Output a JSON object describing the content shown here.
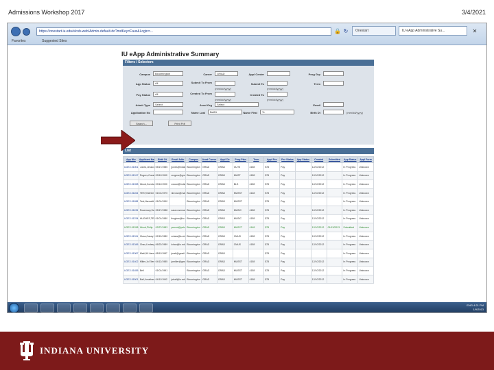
{
  "slide": {
    "header_left": "Admissions Workshop 2017",
    "header_right": "3/4/2021"
  },
  "browser": {
    "address": "https://onestart.iu.edu/slcsb-web/Admin-default.do?mdKey=Faux&Login=...",
    "tab1": "Onestart",
    "tab2": "IU eApp Administrative Su...",
    "fav1": "Favorites",
    "fav2": "Suggested Sites"
  },
  "page": {
    "title": "IU eApp Administrative Summary",
    "filters_header": "Filters / Selectors",
    "list_header": "List",
    "filters": {
      "campus_label": "Campus",
      "campus_value": "Bloomington",
      "career_label": "Career",
      "career_value": "GRAD",
      "appl_center_label": "Appl Center",
      "prog_grp_label": "Prog Grp",
      "app_status_label": "App Status",
      "app_status_value": "All",
      "submit_to_label": "Submit To From",
      "submit_to_note": "(mm/dd/yyyy)",
      "submit_to2_label": "Submit To",
      "submit_to2_note": "(mm/dd/yyyy)",
      "term_label": "Term",
      "pay_status_label": "Pay Status",
      "pay_status_value": "All",
      "created_label": "Created To From",
      "created_note": "(mm/dd/yyyy)",
      "created2_label": "Created To",
      "created2_note": "(mm/dd/yyyy)",
      "admit_type_label": "Admit Type",
      "admit_type_value": "Select",
      "acad_org_label": "Acad Org",
      "acad_org_value": "Select",
      "email_label": "Email",
      "application_no_label": "Application No",
      "name_last_label": "Name Last",
      "name_last_value": "Ball%",
      "name_first_label": "Name First",
      "name_first_value": "%",
      "birth_dt_label": "Birth Dt",
      "birth_dt_note": "(mm/dd/yyyy)",
      "search_button": "Search...",
      "print_button": "Print Pdf"
    },
    "table": {
      "columns": [
        "App Nbr",
        "Applicant Name",
        "Birth Dt",
        "Email Addr",
        "Campus",
        "Acad Career",
        "Appl Ctr",
        "Prog Plan",
        "Term",
        "Appl Fee",
        "Fee Status",
        "App Status",
        "Created",
        "Submitted",
        "App Status",
        "Appl Form"
      ],
      "rows": [
        [
          "UGE2-01001",
          "Jones,Jessica",
          "05/17/1985",
          "jjones@indiana.edu",
          "Bloomington",
          "GRAD",
          "GRAD",
          "GUT5",
          "4158",
          "$75",
          "Pay",
          "",
          "12/10/2012",
          "",
          "In Progress",
          "Unknown"
        ],
        [
          "UGE2-01017",
          "Rogers,Constance Marie",
          "09/11/1990",
          "crogers@gmail.com",
          "Bloomington",
          "GRAD",
          "GRAD",
          "MUST",
          "4158",
          "$75",
          "Pay",
          "",
          "12/10/2012",
          "",
          "In Progress",
          "Unknown"
        ],
        [
          "UGE2-01098",
          "Wood,Constance Marie",
          "09/11/1990",
          "cwood@indiana.edu",
          "Bloomington",
          "GRAD",
          "GRAD",
          "BLS",
          "4158",
          "$75",
          "Pay",
          "",
          "12/10/2012",
          "",
          "In Progress",
          "Unknown"
        ],
        [
          "UGE2-01154",
          "TEST,NANCI EDITH",
          "01/01/1970",
          "nbrown@mail.iu.edu",
          "Bloomington",
          "GRAD",
          "GRAD",
          "MUSST",
          "4148",
          "$75",
          "Pay",
          "",
          "12/10/2012",
          "",
          "In Progress",
          "Unknown"
        ],
        [
          "UGE2-01188",
          "Test,Nannetti",
          "01/01/1990",
          "",
          "Bloomington",
          "GRAD",
          "GRAD",
          "MUSST",
          "",
          "$75",
          "Pay",
          "",
          "",
          "",
          "In Progress",
          "Unknown"
        ],
        [
          "UGE2-01195",
          "Rosemary,Sara Lauden",
          "05/17/1988",
          "sara.rosemary@indiana.edu",
          "Bloomington",
          "GRAD",
          "GRAD",
          "MUSIC",
          "4158",
          "$75",
          "Pay",
          "",
          "12/10/2012",
          "",
          "In Progress",
          "Unknown"
        ],
        [
          "UGE2-01234",
          "HUGHES,TERRY LYNN",
          "01/01/1980",
          "thughes@iu.edu",
          "Bloomington",
          "GRAD",
          "GRAD",
          "MUSIC",
          "4158",
          "$75",
          "Pay",
          "",
          "12/10/2012",
          "",
          "In Progress",
          "Unknown"
        ],
        [
          "UGE2-01298",
          "Wood,Philip",
          "02/27/1983",
          "pwood@yahoo.com",
          "Bloomington",
          "GRAD",
          "GRAD",
          "MUSCT",
          "4148",
          "$75",
          "Pay",
          "",
          "12/10/2012",
          "01/13/2013",
          "Submitted",
          "Unknown"
        ],
        [
          "UGE2-01311",
          "Class,Casey Madison",
          "02/12/1980",
          "cclass@iu.edu",
          "Bloomington",
          "GRAD",
          "GRAD",
          "CMUS",
          "4158",
          "$75",
          "Pay",
          "",
          "12/10/2012",
          "",
          "In Progress",
          "Unknown"
        ],
        [
          "UGE2-01345",
          "Chau,Lindsey",
          "06/22/1989",
          "lchau@iu.edu",
          "Bloomington",
          "GRAD",
          "GRAD",
          "CMUS",
          "4158",
          "$75",
          "Pay",
          "",
          "12/10/2012",
          "",
          "In Progress",
          "Unknown"
        ],
        [
          "UGE2-01367",
          "Matt,Jill Lianne",
          "08/11/1987",
          "jmatt@gmail.com",
          "Bloomington",
          "GRAD",
          "GRAD",
          "",
          "",
          "$75",
          "Pay",
          "",
          "",
          "",
          "In Progress",
          "Unknown"
        ],
        [
          "UGE2-01402",
          "Miller,Jo Ellen",
          "04/12/1985",
          "jomiller@gmail.com",
          "Bloomington",
          "GRAD",
          "GRAD",
          "MUSST",
          "4158",
          "$75",
          "Pay",
          "",
          "12/10/2012",
          "",
          "In Progress",
          "Unknown"
        ],
        [
          "UGE2-01455",
          "Bell",
          "01/01/1991",
          "",
          "Bloomington",
          "GRAD",
          "GRAD",
          "MUSST",
          "4158",
          "$75",
          "Pay",
          "",
          "12/10/2012",
          "",
          "In Progress",
          "Unknown"
        ],
        [
          "UGE2-01501",
          "Ball,Jonathan Oliver",
          "04/11/1992",
          "joball@iu.edu",
          "Bloomington",
          "GRAD",
          "GRAD",
          "MUSST",
          "4158",
          "$75",
          "Pay",
          "",
          "12/10/2012",
          "",
          "In Progress",
          "Unknown"
        ]
      ]
    }
  },
  "taskbar": {
    "lang": "ENG",
    "time": "4:21 PM",
    "date": "1/9/2013"
  },
  "footer": {
    "university": "INDIANA UNIVERSITY"
  },
  "colors": {
    "accent": "#7d1a1a",
    "arrow": "#8b1a1a",
    "section_bar": "#4a6f96"
  }
}
